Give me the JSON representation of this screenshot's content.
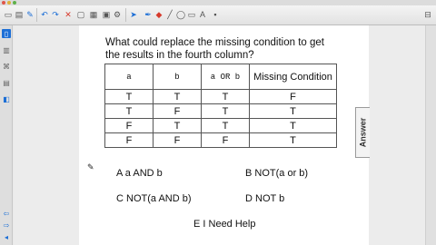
{
  "colors": {
    "toolbar_blue": "#1d6fd6",
    "toolbar_red": "#d63a2c",
    "link": "#2b4fd8"
  },
  "toolbar": {
    "icons": [
      "open-icon",
      "save-icon",
      "pen-icon",
      "undo-icon",
      "redo-icon",
      "delete-icon",
      "screen-icon",
      "table-icon",
      "tools-icon",
      "select-icon",
      "pen-tool-icon",
      "eraser-icon",
      "line-icon",
      "shape-icon",
      "fill-icon",
      "text-icon",
      "color-icon"
    ]
  },
  "question": {
    "text": "What could replace the missing condition to get the results in the fourth column?"
  },
  "table": {
    "headers": [
      "a",
      "b",
      "a OR b",
      "Missing Condition"
    ],
    "rows": [
      [
        "T",
        "T",
        "T",
        "F"
      ],
      [
        "T",
        "F",
        "T",
        "T"
      ],
      [
        "F",
        "T",
        "T",
        "T"
      ],
      [
        "F",
        "F",
        "F",
        "T"
      ]
    ]
  },
  "choices": {
    "a": "A  a AND b",
    "b": "B  NOT(a or b)",
    "c": "C  NOT(a AND b)",
    "d": "D  NOT b",
    "e": "E  I Need Help"
  },
  "answer_tab": "Answer"
}
